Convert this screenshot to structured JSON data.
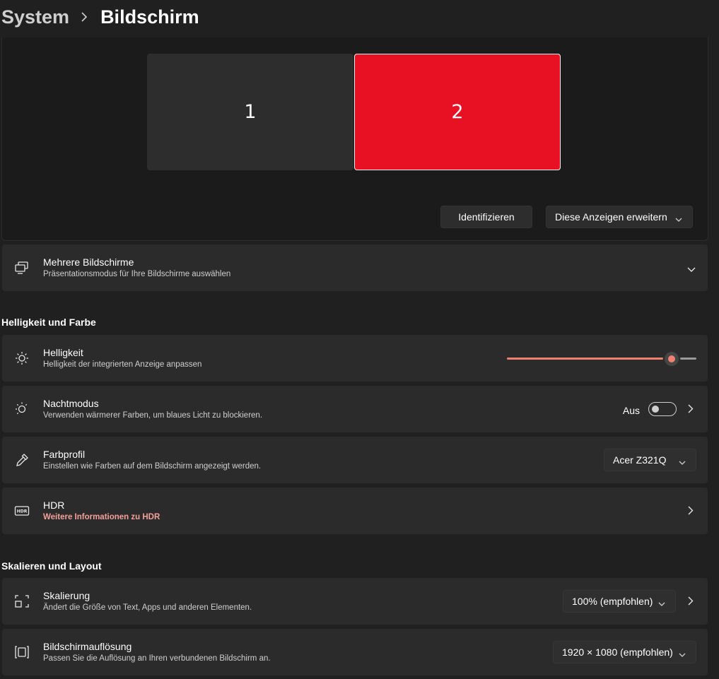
{
  "breadcrumb": {
    "parent": "System",
    "separator": "›",
    "current": "Bildschirm"
  },
  "display_panel": {
    "monitors": [
      {
        "label": "1"
      },
      {
        "label": "2"
      }
    ],
    "identify_label": "Identifizieren",
    "mode_dropdown": {
      "value": "Diese Anzeigen erweitern"
    }
  },
  "multiple_displays": {
    "title": "Mehrere Bildschirme",
    "subtitle": "Präsentationsmodus für Ihre Bildschirme auswählen",
    "icon": "multiple-displays-icon"
  },
  "section_brightness": "Helligkeit und Farbe",
  "brightness": {
    "title": "Helligkeit",
    "subtitle": "Helligkeit der integrierten Anzeige anpassen",
    "icon": "sun-icon",
    "value_fraction": 0.87
  },
  "night_mode": {
    "title": "Nachtmodus",
    "subtitle": "Verwenden wärmerer Farben, um blaues Licht zu blockieren.",
    "icon": "night-light-icon",
    "state_label": "Aus"
  },
  "color_profile": {
    "title": "Farbprofil",
    "subtitle": "Einstellen wie Farben auf dem Bildschirm angezeigt werden.",
    "icon": "eyedropper-icon",
    "value": "Acer Z321Q"
  },
  "hdr": {
    "title": "HDR",
    "link": "Weitere Informationen zu HDR",
    "icon": "hdr-icon"
  },
  "section_scale": "Skalieren und Layout",
  "scaling": {
    "title": "Skalierung",
    "subtitle": "Ändert die Größe von Text, Apps und anderen Elementen.",
    "icon": "scale-icon",
    "value": "100% (empfohlen)"
  },
  "resolution": {
    "title": "Bildschirmauflösung",
    "subtitle": "Passen Sie die Auflösung an Ihren verbundenen Bildschirm an.",
    "icon": "resolution-icon",
    "value": "1920 × 1080 (empfohlen)"
  },
  "colors": {
    "accent": "#f08070",
    "selected_monitor": "#e81123",
    "card": "#2b2b2b",
    "background": "#202020",
    "link": "#f4a09a"
  }
}
